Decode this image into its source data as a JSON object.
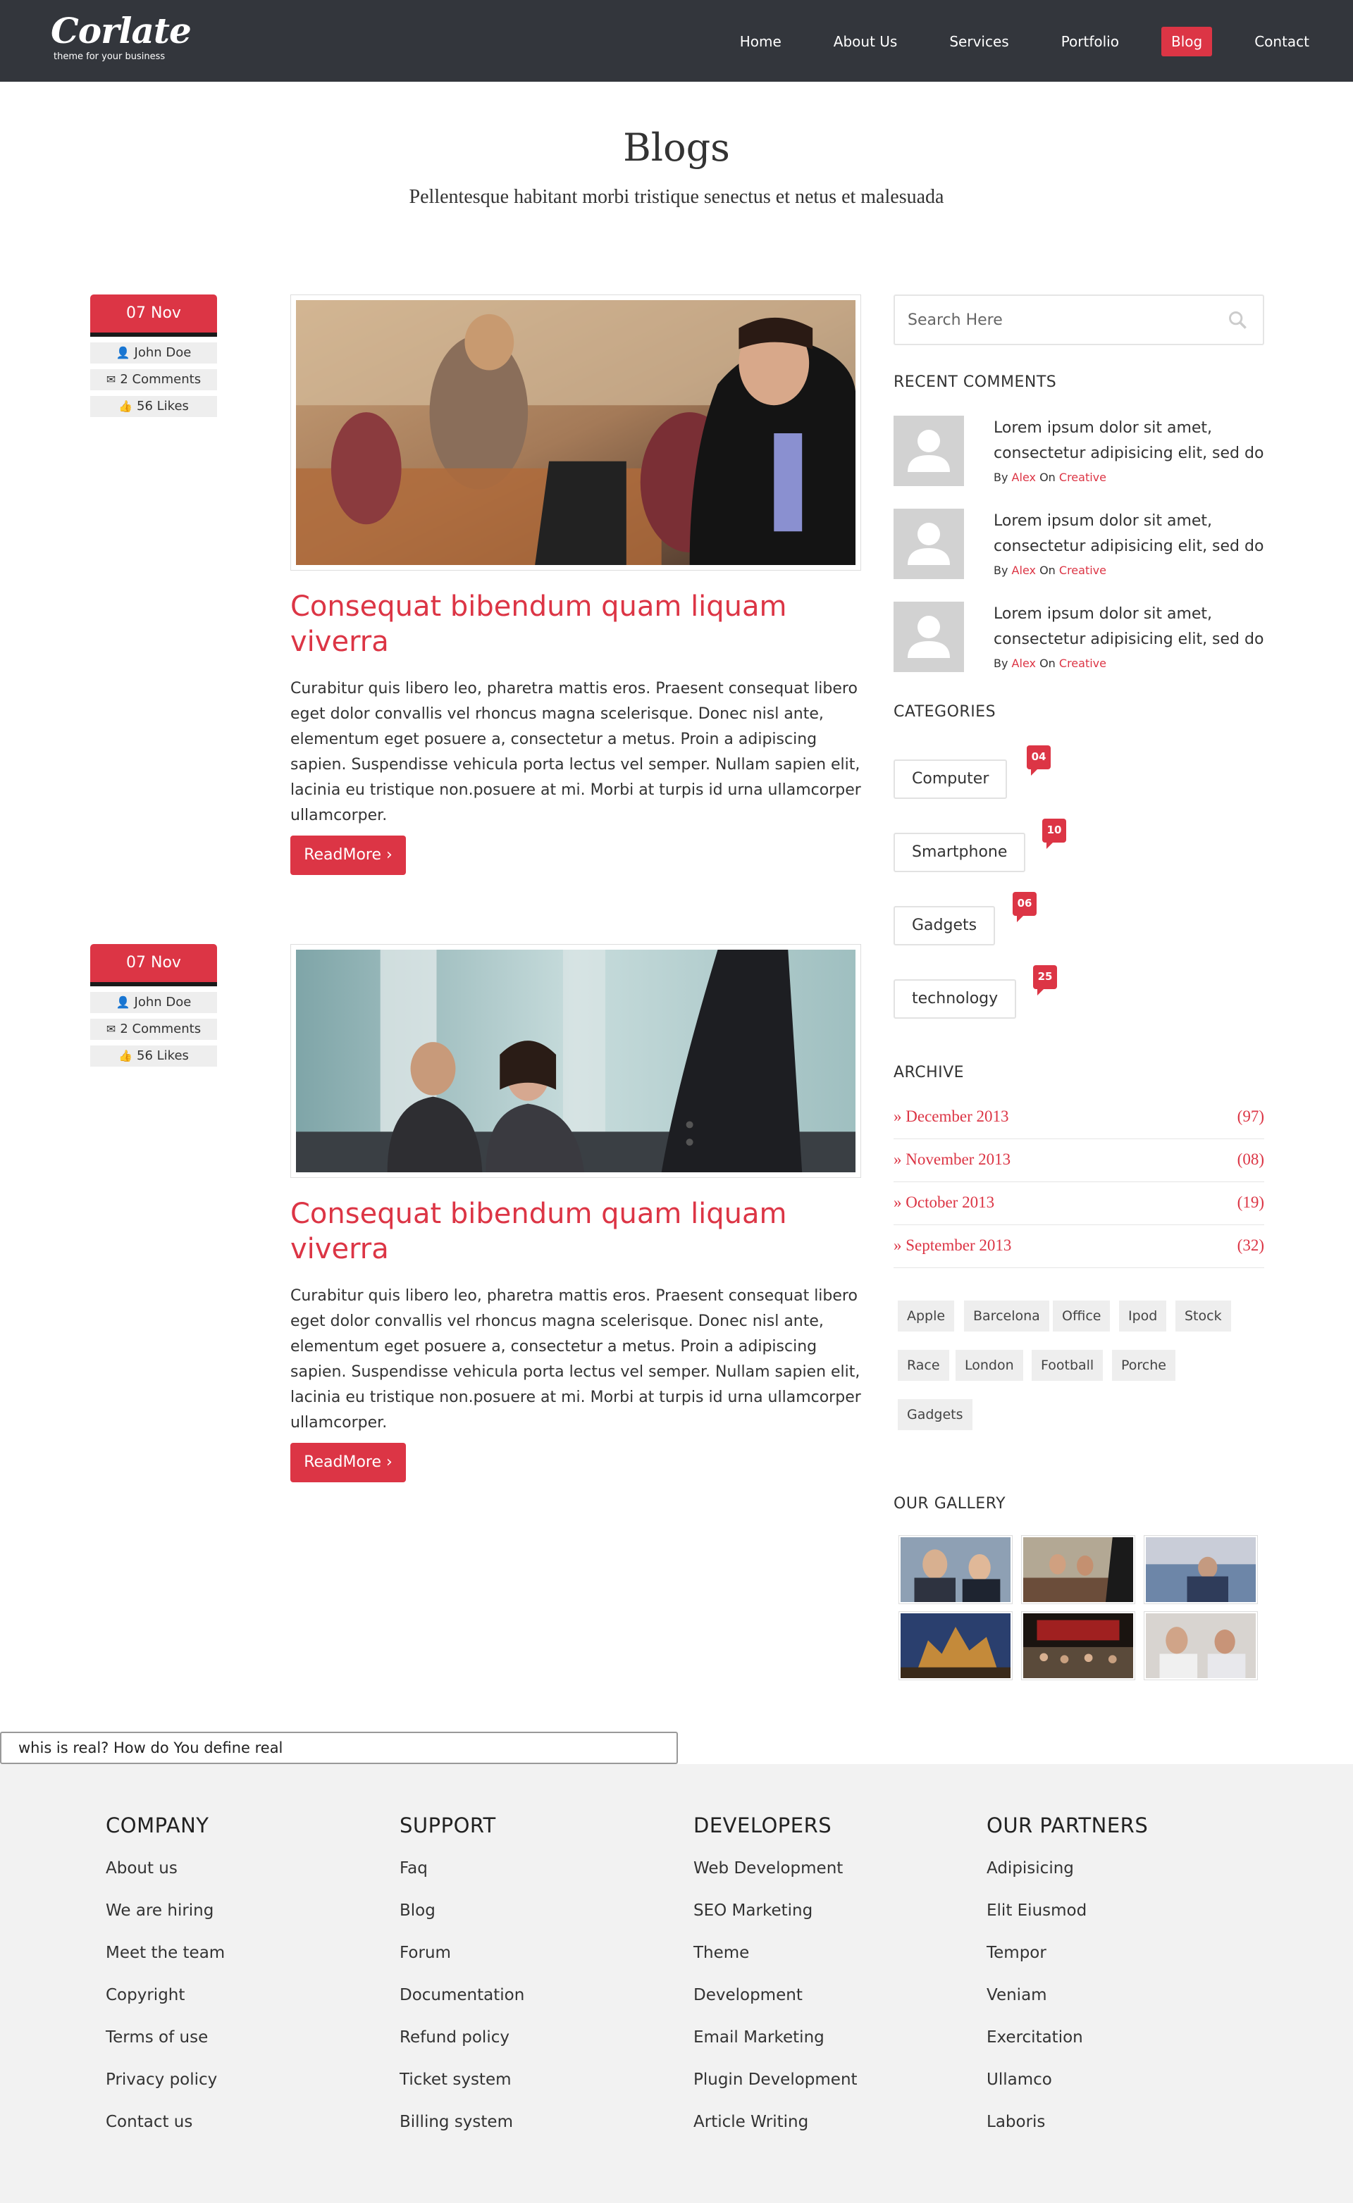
{
  "brand": {
    "name": "Corlate",
    "tagline": "theme for your business"
  },
  "nav": {
    "items": [
      "Home",
      "About Us",
      "Services",
      "Portfolio",
      "Blog",
      "Contact"
    ],
    "active": "Blog"
  },
  "header": {
    "title": "Blogs",
    "subtitle": "Pellentesque habitant morbi tristique senectus et netus et malesuada"
  },
  "posts": [
    {
      "date": "07 Nov",
      "author": "John Doe",
      "comments": "2 Comments",
      "likes": "56 Likes",
      "title": "Consequat bibendum quam liquam viverra",
      "body": "Curabitur quis libero leo, pharetra mattis eros. Praesent consequat libero eget dolor convallis vel rhoncus magna scelerisque. Donec nisl ante, elementum eget posuere a, consectetur a metus. Proin a adipiscing sapien. Suspendisse vehicula porta lectus vel semper. Nullam sapien elit, lacinia eu tristique non.posuere at mi. Morbi at turpis id urna ullamcorper ullamcorper.",
      "readmore": "ReadMore ›"
    },
    {
      "date": "07 Nov",
      "author": "John Doe",
      "comments": "2 Comments",
      "likes": "56 Likes",
      "title": "Consequat bibendum quam liquam viverra",
      "body": "Curabitur quis libero leo, pharetra mattis eros. Praesent consequat libero eget dolor convallis vel rhoncus magna scelerisque. Donec nisl ante, elementum eget posuere a, consectetur a metus. Proin a adipiscing sapien. Suspendisse vehicula porta lectus vel semper. Nullam sapien elit, lacinia eu tristique non.posuere at mi. Morbi at turpis id urna ullamcorper ullamcorper.",
      "readmore": "ReadMore ›"
    }
  ],
  "sidebar": {
    "search_placeholder": "Search Here",
    "recent_heading": "RECENT COMMENTS",
    "recent": [
      {
        "text": "Lorem ipsum dolor sit amet, consectetur adipisicing elit, sed do",
        "by": "By",
        "author": "Alex",
        "on": "On",
        "cat": "Creative"
      },
      {
        "text": "Lorem ipsum dolor sit amet, consectetur adipisicing elit, sed do",
        "by": "By",
        "author": "Alex",
        "on": "On",
        "cat": "Creative"
      },
      {
        "text": "Lorem ipsum dolor sit amet, consectetur adipisicing elit, sed do",
        "by": "By",
        "author": "Alex",
        "on": "On",
        "cat": "Creative"
      }
    ],
    "categories_heading": "CATEGORIES",
    "categories": [
      {
        "name": "Computer",
        "count": "04"
      },
      {
        "name": "Smartphone",
        "count": "10"
      },
      {
        "name": "Gadgets",
        "count": "06"
      },
      {
        "name": "technology",
        "count": "25"
      }
    ],
    "archive_heading": "ARCHIVE",
    "archive": [
      {
        "label": "» December 2013",
        "count": "(97)"
      },
      {
        "label": "» November 2013",
        "count": "(08)"
      },
      {
        "label": "» October 2013",
        "count": "(19)"
      },
      {
        "label": "» September 2013",
        "count": "(32)"
      }
    ],
    "tags": [
      "Apple",
      "Barcelona",
      "Office",
      "Ipod",
      "Stock",
      "Race",
      "London",
      "Football",
      "Porche",
      "Gadgets"
    ],
    "gallery_heading": "OUR GALLERY"
  },
  "chat": {
    "value": "whis is real? How do You define real"
  },
  "footer": {
    "columns": [
      {
        "heading": "COMPANY",
        "links": [
          "About us",
          "We are hiring",
          "Meet the team",
          "Copyright",
          "Terms of use",
          "Privacy policy",
          "Contact us"
        ]
      },
      {
        "heading": "SUPPORT",
        "links": [
          "Faq",
          "Blog",
          "Forum",
          "Documentation",
          "Refund policy",
          "Ticket system",
          "Billing system"
        ]
      },
      {
        "heading": "DEVELOPERS",
        "links": [
          "Web Development",
          "SEO Marketing",
          "Theme",
          "Development",
          "Email Marketing",
          "Plugin Development",
          "Article Writing"
        ]
      },
      {
        "heading": "OUR PARTNERS",
        "links": [
          "Adipisicing",
          "Elit Eiusmod",
          "Tempor",
          "Veniam",
          "Exercitation",
          "Ullamco",
          "Laboris"
        ]
      }
    ]
  },
  "colors": {
    "accent": "#dc3545",
    "navbar": "#33363c",
    "footer": "#f2f2f2"
  }
}
